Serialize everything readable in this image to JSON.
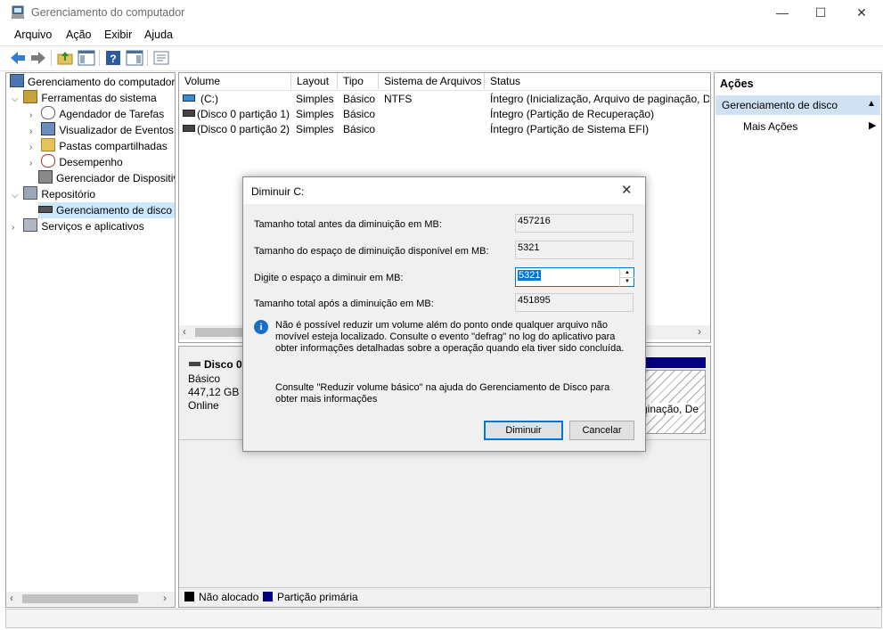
{
  "window": {
    "title": "Gerenciamento do computador",
    "buttons": {
      "minimize": "—",
      "maximize": "☐",
      "close": "✕"
    }
  },
  "menu": [
    "Arquivo",
    "Ação",
    "Exibir",
    "Ajuda"
  ],
  "tree": {
    "root": "Gerenciamento do computador",
    "system_tools": "Ferramentas do sistema",
    "task_scheduler": "Agendador de Tarefas",
    "event_viewer": "Visualizador de Eventos",
    "shared_folders": "Pastas compartilhadas",
    "performance": "Desempenho",
    "device_manager": "Gerenciador de Dispositivos",
    "storage": "Repositório",
    "disk_management": "Gerenciamento de disco",
    "services": "Serviços e aplicativos"
  },
  "volumes": {
    "columns": [
      "Volume",
      "Layout",
      "Tipo",
      "Sistema de Arquivos",
      "Status"
    ],
    "rows": [
      {
        "volume": "(C:)",
        "layout": "Simples",
        "tipo": "Básico",
        "fs": "NTFS",
        "status": "Íntegro (Inicialização, Arquivo de paginação, D"
      },
      {
        "volume": "(Disco 0 partição 1)",
        "layout": "Simples",
        "tipo": "Básico",
        "fs": "",
        "status": "Íntegro (Partição de Recuperação)"
      },
      {
        "volume": "(Disco 0 partição 2)",
        "layout": "Simples",
        "tipo": "Básico",
        "fs": "",
        "status": "Íntegro (Partição de Sistema EFI)"
      }
    ]
  },
  "disk": {
    "name": "Disco 0",
    "type": "Básico",
    "size": "447,12 GB",
    "state": "Online",
    "partition_text": "ginação, De"
  },
  "legend": {
    "unallocated": "Não alocado",
    "primary": "Partição primária",
    "unallocated_color": "#000000",
    "primary_color": "#000080"
  },
  "actions": {
    "header": "Ações",
    "section": "Gerenciamento de disco",
    "more": "Mais Ações"
  },
  "dialog": {
    "title": "Diminuir C:",
    "total_before_label": "Tamanho total antes da diminuição em MB:",
    "total_before_value": "457216",
    "available_label": "Tamanho do espaço de diminuição disponível em MB:",
    "available_value": "5321",
    "enter_label": "Digite o espaço a diminuir em MB:",
    "enter_value": "5321",
    "total_after_label": "Tamanho total após a diminuição em MB:",
    "total_after_value": "451895",
    "info_text": "Não é possível reduzir um volume além do ponto onde qualquer arquivo não movível esteja localizado. Consulte o evento \"defrag\" no log do aplicativo para obter informações detalhadas sobre a operação quando ela tiver sido concluída.",
    "help_text": "Consulte \"Reduzir volume básico\" na ajuda do Gerenciamento de Disco para obter mais informações",
    "ok": "Diminuir",
    "cancel": "Cancelar"
  }
}
